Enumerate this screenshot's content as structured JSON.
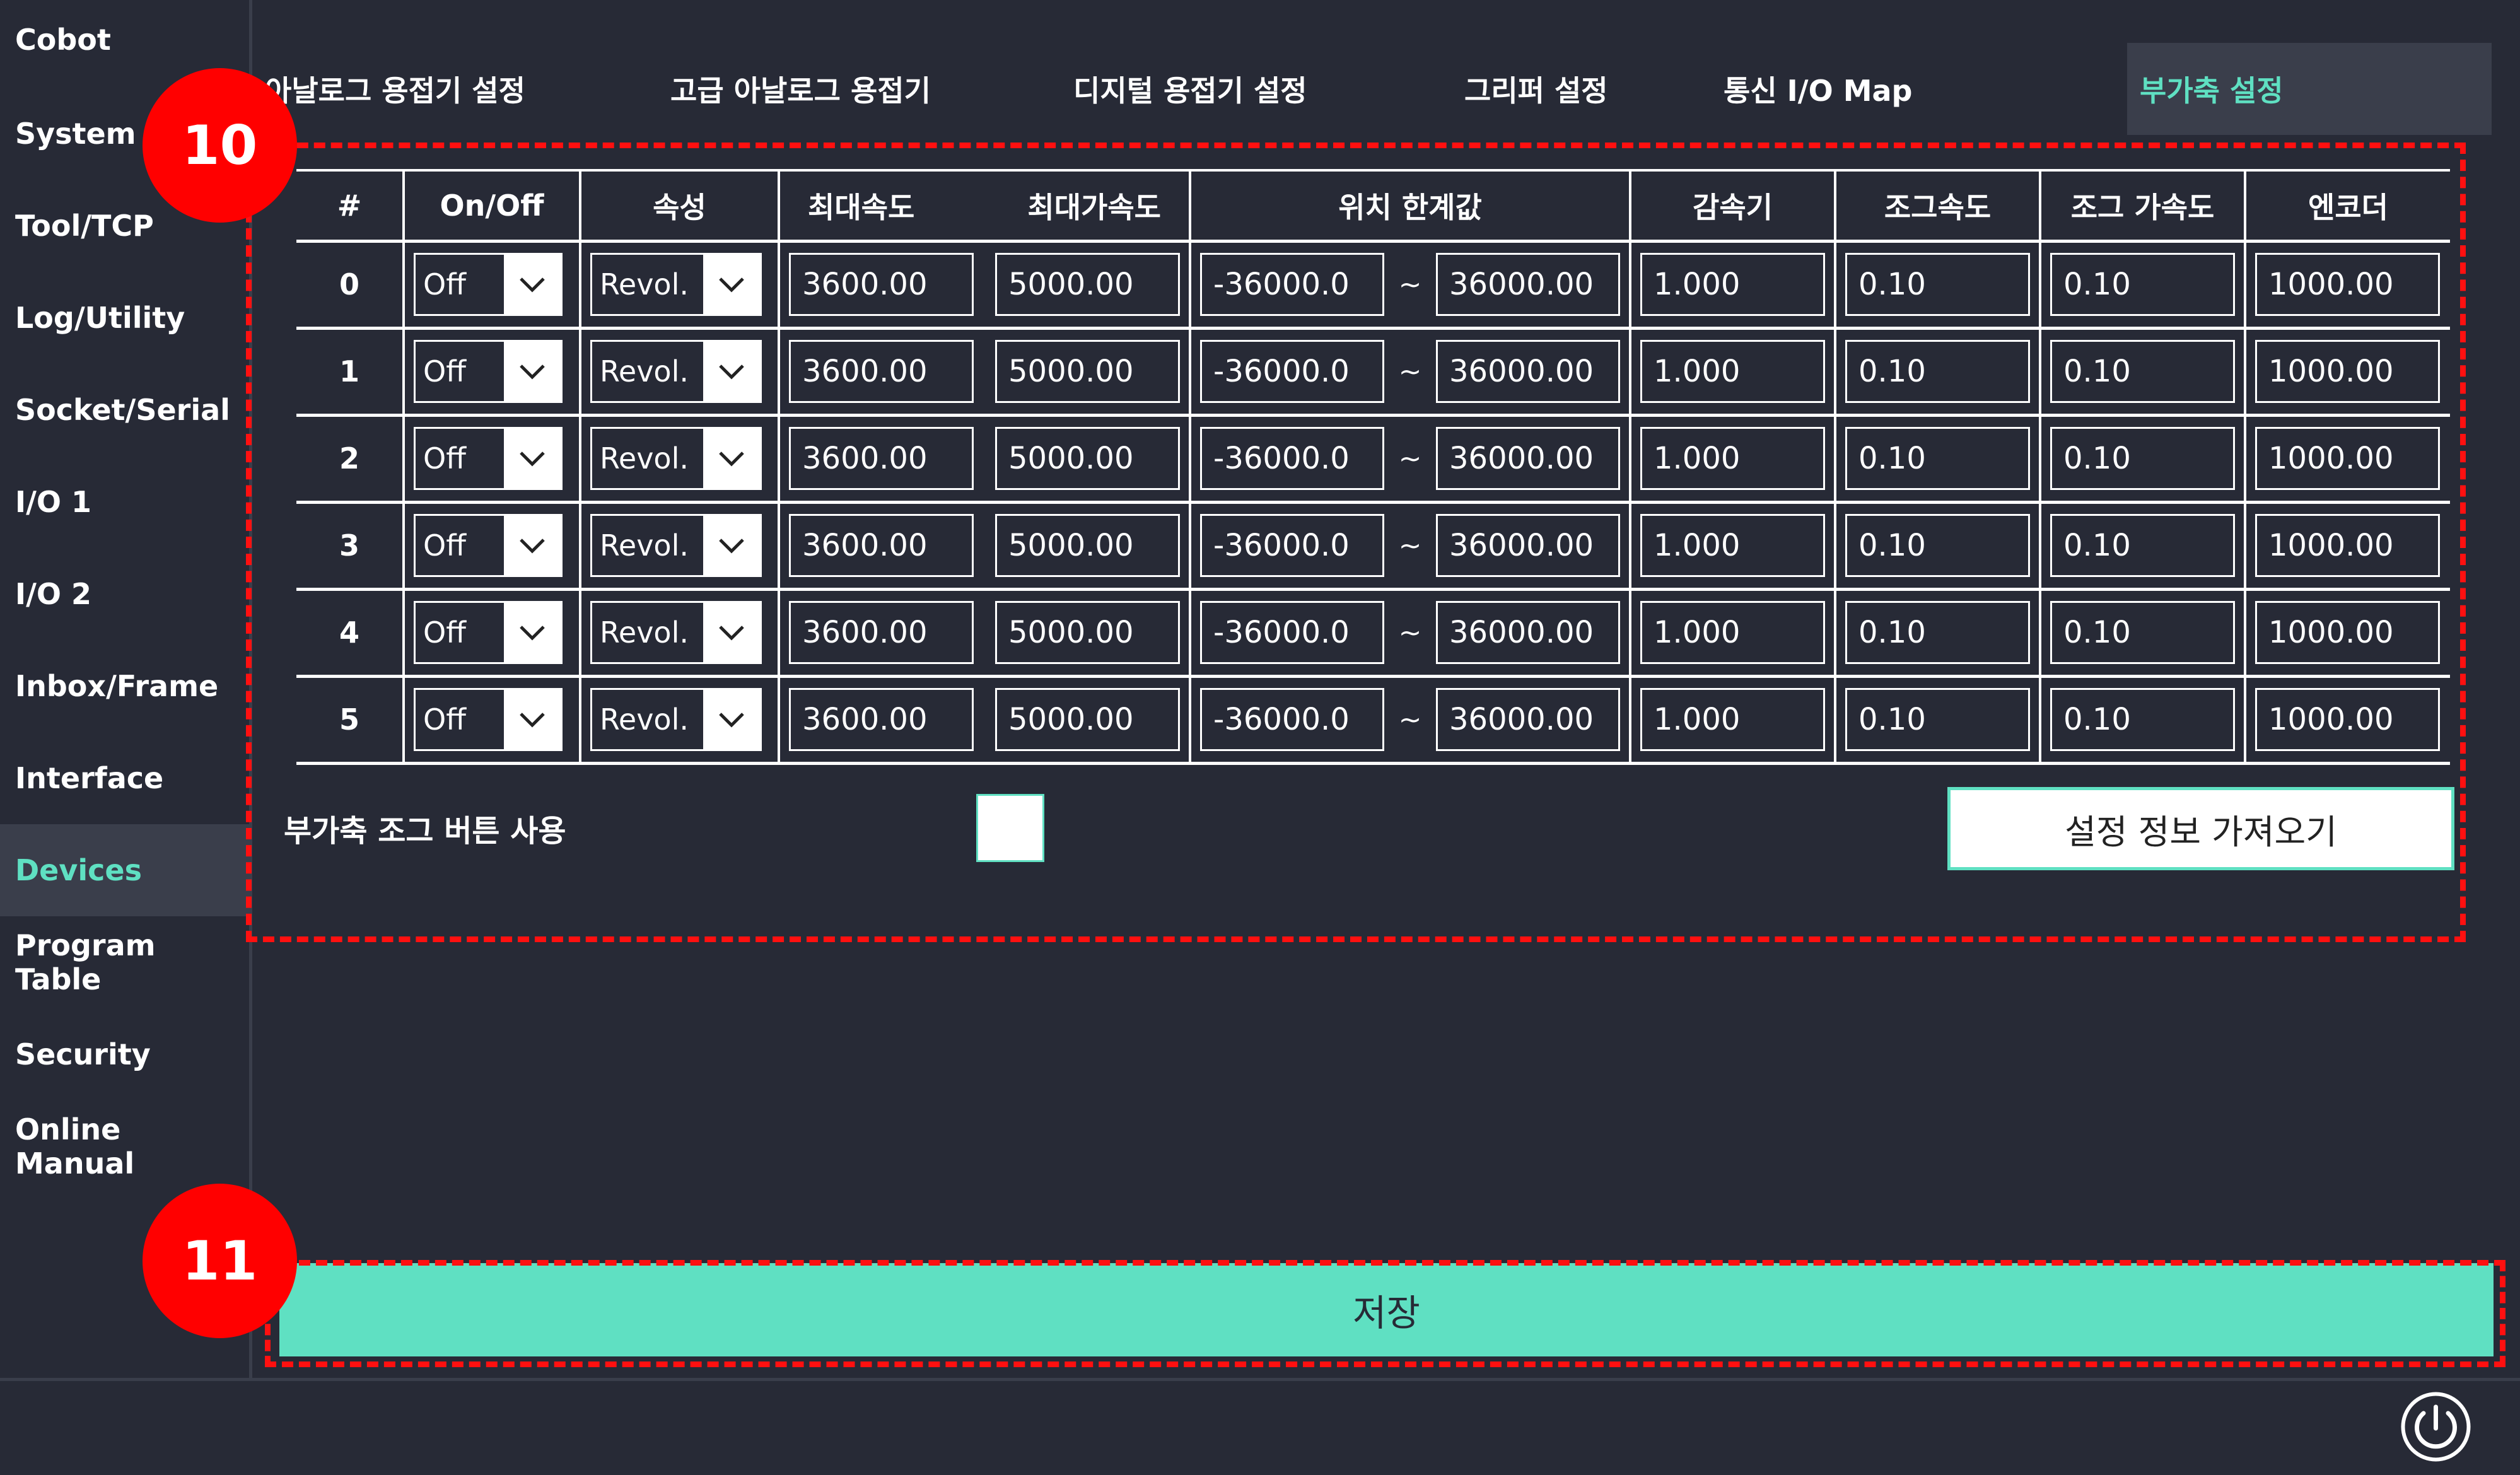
{
  "sidebar": {
    "items": [
      {
        "label": "Cobot"
      },
      {
        "label": "System"
      },
      {
        "label": "Tool/TCP"
      },
      {
        "label": "Log/Utility"
      },
      {
        "label": "Socket/Serial"
      },
      {
        "label": "I/O 1"
      },
      {
        "label": "I/O 2"
      },
      {
        "label": "Inbox/Frame"
      },
      {
        "label": "Interface"
      },
      {
        "label": "Devices",
        "active": true
      },
      {
        "label": "Program Table"
      },
      {
        "label": "Security"
      },
      {
        "label": "Online Manual"
      }
    ]
  },
  "tabs": [
    {
      "label": "아날로그 용접기 설정"
    },
    {
      "label": "고급 아날로그 용접기"
    },
    {
      "label": "디지털 용접기 설정"
    },
    {
      "label": "그리퍼 설정"
    },
    {
      "label": "통신 I/O Map"
    },
    {
      "label": "부가축 설정",
      "active": true
    }
  ],
  "table": {
    "headers": [
      "#",
      "On/Off",
      "속성",
      "최대속도",
      "최대가속도",
      "위치 한계값",
      "감속기",
      "조그속도",
      "조그 가속도",
      "엔코더"
    ],
    "range_separator": "~",
    "rows": [
      {
        "index": "0",
        "onoff": "Off",
        "attr": "Revol.",
        "max_speed": "3600.00",
        "max_accel": "5000.00",
        "pos_min": "-36000.0",
        "pos_max": "36000.00",
        "reducer": "1.000",
        "jog_speed": "0.10",
        "jog_accel": "0.10",
        "encoder": "1000.00"
      },
      {
        "index": "1",
        "onoff": "Off",
        "attr": "Revol.",
        "max_speed": "3600.00",
        "max_accel": "5000.00",
        "pos_min": "-36000.0",
        "pos_max": "36000.00",
        "reducer": "1.000",
        "jog_speed": "0.10",
        "jog_accel": "0.10",
        "encoder": "1000.00"
      },
      {
        "index": "2",
        "onoff": "Off",
        "attr": "Revol.",
        "max_speed": "3600.00",
        "max_accel": "5000.00",
        "pos_min": "-36000.0",
        "pos_max": "36000.00",
        "reducer": "1.000",
        "jog_speed": "0.10",
        "jog_accel": "0.10",
        "encoder": "1000.00"
      },
      {
        "index": "3",
        "onoff": "Off",
        "attr": "Revol.",
        "max_speed": "3600.00",
        "max_accel": "5000.00",
        "pos_min": "-36000.0",
        "pos_max": "36000.00",
        "reducer": "1.000",
        "jog_speed": "0.10",
        "jog_accel": "0.10",
        "encoder": "1000.00"
      },
      {
        "index": "4",
        "onoff": "Off",
        "attr": "Revol.",
        "max_speed": "3600.00",
        "max_accel": "5000.00",
        "pos_min": "-36000.0",
        "pos_max": "36000.00",
        "reducer": "1.000",
        "jog_speed": "0.10",
        "jog_accel": "0.10",
        "encoder": "1000.00"
      },
      {
        "index": "5",
        "onoff": "Off",
        "attr": "Revol.",
        "max_speed": "3600.00",
        "max_accel": "5000.00",
        "pos_min": "-36000.0",
        "pos_max": "36000.00",
        "reducer": "1.000",
        "jog_speed": "0.10",
        "jog_accel": "0.10",
        "encoder": "1000.00"
      }
    ]
  },
  "jog_option": {
    "label": "부가축 조그 버튼 사용",
    "checked": false
  },
  "fetch_button": {
    "label": "설정 정보 가져오기"
  },
  "save_button": {
    "label": "저장"
  },
  "annotations": {
    "badge_1": "10",
    "badge_2": "11"
  },
  "colors": {
    "accent": "#5fe0c2",
    "background": "#272a36",
    "panel": "#3a3e4b",
    "annotation": "#ff1010"
  },
  "icons": {
    "dropdown": "chevron-down-icon",
    "power": "power-icon"
  }
}
